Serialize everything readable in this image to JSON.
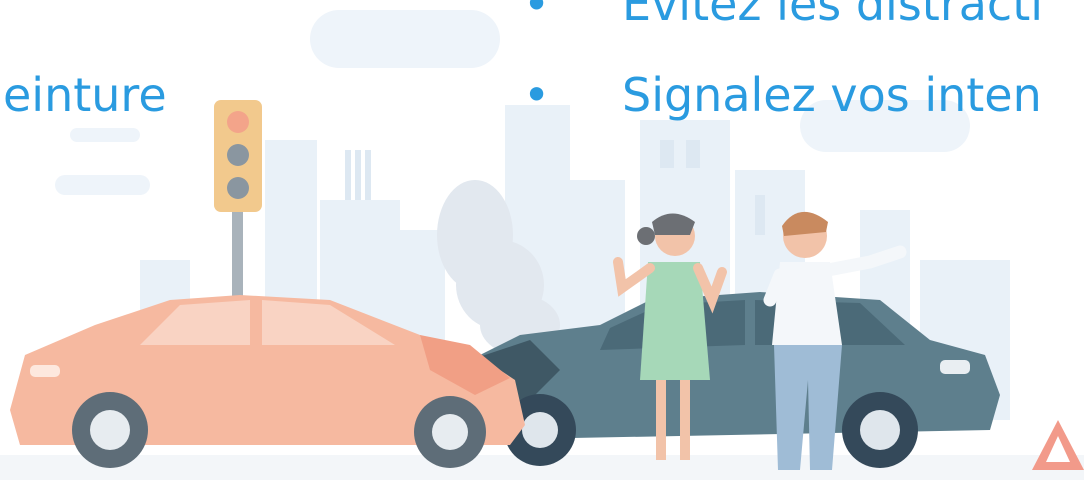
{
  "slide": {
    "bullet_char": "•",
    "bullets": [
      {
        "text": "Évitez les distracti"
      },
      {
        "text": "Signalez vos inten"
      }
    ],
    "left_fragment": "einture"
  },
  "colors": {
    "text_accent": "#2a9be0",
    "car_left": "#f6b9a0",
    "car_right": "#5e7f8d",
    "woman_dress": "#a6d8b8",
    "man_shirt": "#f4f7fa",
    "man_pants": "#9fbcd6",
    "sky_buildings": "#e7f0f8"
  }
}
